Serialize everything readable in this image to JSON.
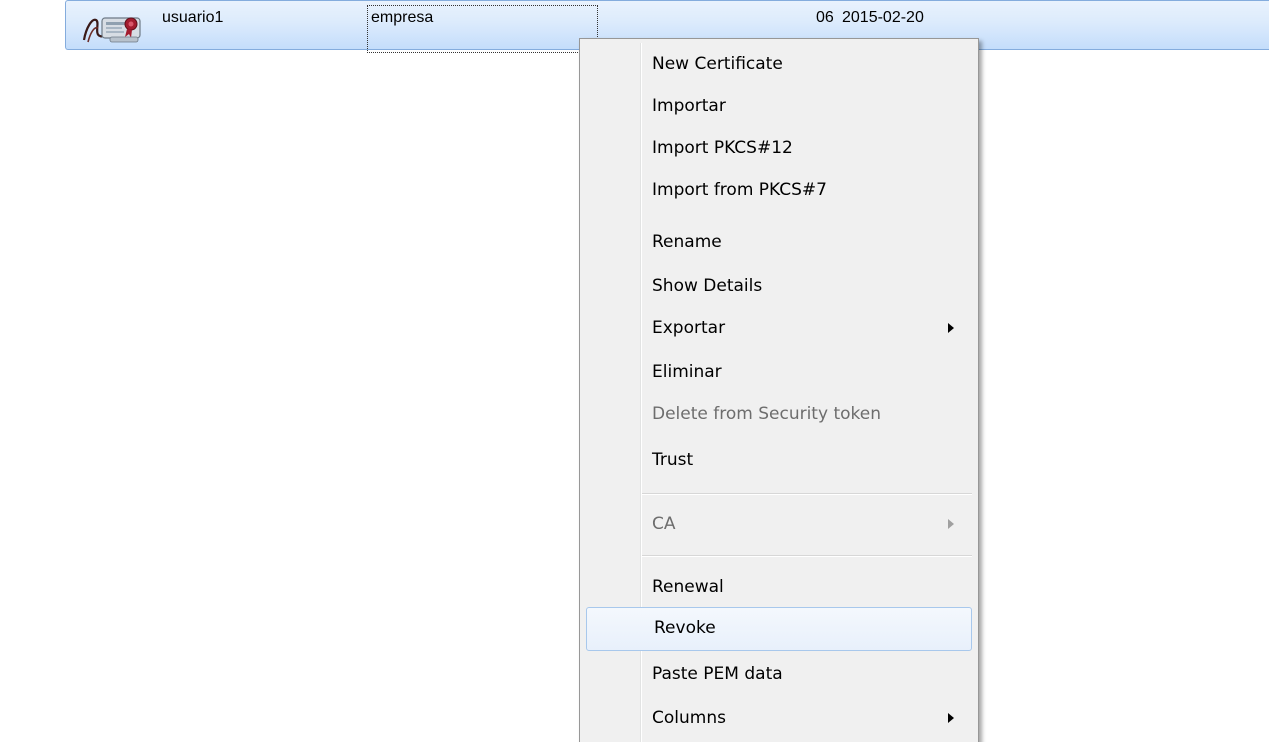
{
  "certificate_list": {
    "selected_row": {
      "icon": "certificate-icon",
      "name": "usuario1",
      "organization": "empresa",
      "serial": "06",
      "date": "2015-02-20"
    }
  },
  "context_menu": {
    "items": [
      {
        "label": "New Certificate",
        "enabled": true,
        "submenu": false
      },
      {
        "label": "Importar",
        "enabled": true,
        "submenu": false
      },
      {
        "label": "Import PKCS#12",
        "enabled": true,
        "submenu": false
      },
      {
        "label": "Import from PKCS#7",
        "enabled": true,
        "submenu": false
      },
      {
        "label": "Rename",
        "enabled": true,
        "submenu": false
      },
      {
        "label": "Show Details",
        "enabled": true,
        "submenu": false
      },
      {
        "label": "Exportar",
        "enabled": true,
        "submenu": true
      },
      {
        "label": "Eliminar",
        "enabled": true,
        "submenu": false
      },
      {
        "label": "Delete from Security token",
        "enabled": false,
        "submenu": false
      },
      {
        "label": "Trust",
        "enabled": true,
        "submenu": false
      },
      {
        "label": "CA",
        "enabled": false,
        "submenu": true
      },
      {
        "label": "Renewal",
        "enabled": true,
        "submenu": false
      },
      {
        "label": "Revoke",
        "enabled": true,
        "submenu": false,
        "highlighted": true
      },
      {
        "label": "Paste PEM data",
        "enabled": true,
        "submenu": false
      },
      {
        "label": "Columns",
        "enabled": true,
        "submenu": true
      }
    ]
  },
  "colors": {
    "selection": "#c4ddfb",
    "menu_background": "#f0f0f0",
    "hover_border": "#a8c8ec",
    "disabled_text": "#6d6d6d"
  }
}
